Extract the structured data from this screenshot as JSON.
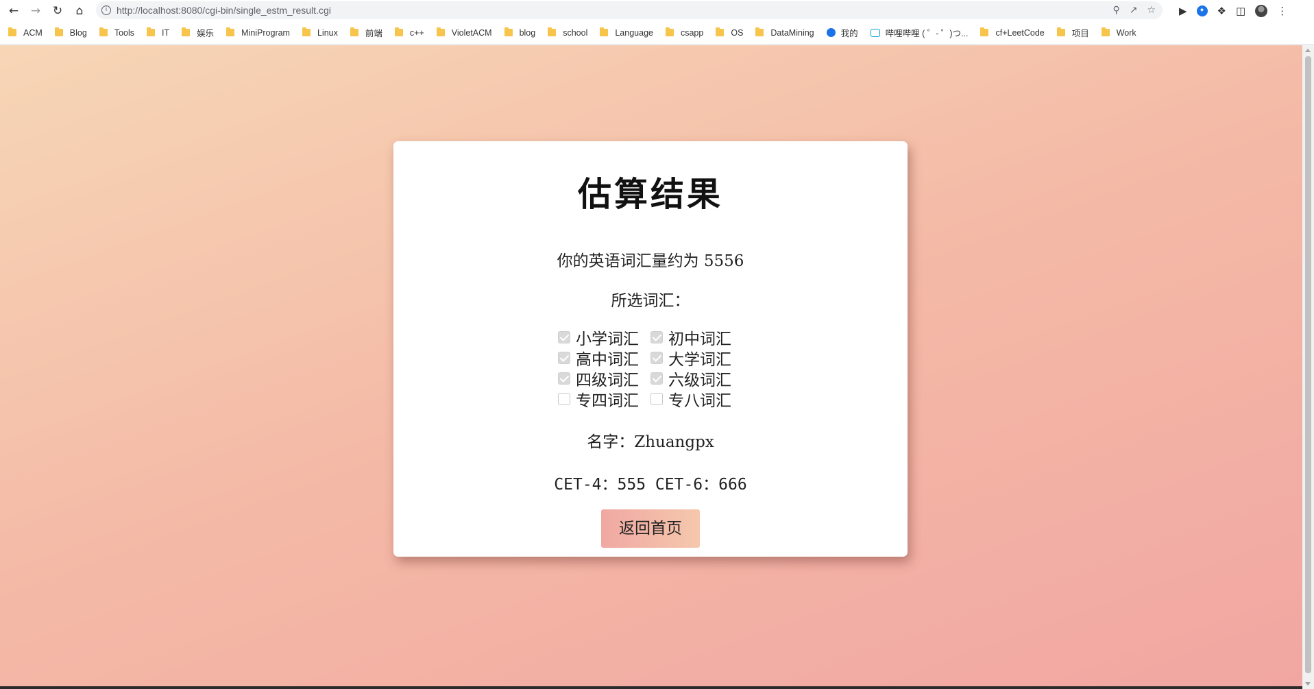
{
  "browser": {
    "url": "http://localhost:8080/cgi-bin/single_estm_result.cgi",
    "icons": [
      "back-icon",
      "forward-icon",
      "reload-icon",
      "home-icon",
      "info-icon",
      "zoom-icon",
      "share-icon",
      "star-icon",
      "play-icon",
      "extension-icon",
      "puzzle-icon",
      "sidepanel-icon",
      "profile-avatar",
      "menu-icon"
    ]
  },
  "bookmarks": [
    {
      "label": "ACM",
      "type": "folder"
    },
    {
      "label": "Blog",
      "type": "folder"
    },
    {
      "label": "Tools",
      "type": "folder"
    },
    {
      "label": "IT",
      "type": "folder"
    },
    {
      "label": "娱乐",
      "type": "folder"
    },
    {
      "label": "MiniProgram",
      "type": "folder"
    },
    {
      "label": "Linux",
      "type": "folder"
    },
    {
      "label": "前端",
      "type": "folder"
    },
    {
      "label": "c++",
      "type": "folder"
    },
    {
      "label": "VioletACM",
      "type": "folder"
    },
    {
      "label": "blog",
      "type": "folder"
    },
    {
      "label": "school",
      "type": "folder"
    },
    {
      "label": "Language",
      "type": "folder"
    },
    {
      "label": "csapp",
      "type": "folder"
    },
    {
      "label": "OS",
      "type": "folder"
    },
    {
      "label": "DataMining",
      "type": "folder"
    },
    {
      "label": "我的",
      "type": "site"
    },
    {
      "label": "哔哩哔哩 ( ゜- ゜)つ...",
      "type": "bilibili"
    },
    {
      "label": "cf+LeetCode",
      "type": "folder"
    },
    {
      "label": "项目",
      "type": "folder"
    },
    {
      "label": "Work",
      "type": "folder"
    }
  ],
  "card": {
    "title": "估算结果",
    "result_text": "你的英语词汇量约为 5556",
    "vocab_label": "所选词汇：",
    "options": [
      {
        "label": "小学词汇",
        "checked": true
      },
      {
        "label": "初中词汇",
        "checked": true
      },
      {
        "label": "高中词汇",
        "checked": true
      },
      {
        "label": "大学词汇",
        "checked": true
      },
      {
        "label": "四级词汇",
        "checked": true
      },
      {
        "label": "六级词汇",
        "checked": true
      },
      {
        "label": "专四词汇",
        "checked": false
      },
      {
        "label": "专八词汇",
        "checked": false
      }
    ],
    "name_text": "名字：Zhuangpx",
    "cet_text": "CET-4：555 CET-6：666",
    "home_button": "返回首页"
  },
  "colors": {
    "bg_start": "#f7d6b6",
    "bg_end": "#f1a6a2",
    "button_start": "#f0a8a2",
    "button_end": "#f5c8ad"
  }
}
